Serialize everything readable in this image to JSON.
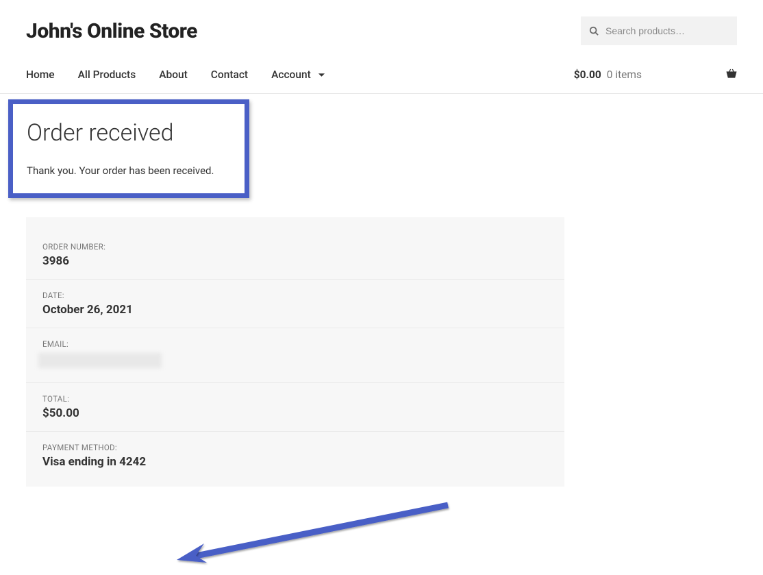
{
  "header": {
    "site_title": "John's Online Store",
    "search_placeholder": "Search products…"
  },
  "nav": {
    "items": [
      "Home",
      "All Products",
      "About",
      "Contact",
      "Account"
    ]
  },
  "cart": {
    "amount": "$0.00",
    "items_text": "0 items"
  },
  "order": {
    "page_title": "Order received",
    "thank_you": "Thank you. Your order has been received.",
    "fields": {
      "order_number_label": "ORDER NUMBER:",
      "order_number": "3986",
      "date_label": "DATE:",
      "date": "October 26, 2021",
      "email_label": "EMAIL:",
      "email": "",
      "total_label": "TOTAL:",
      "total": "$50.00",
      "payment_method_label": "PAYMENT METHOD:",
      "payment_method": "Visa ending in 4242"
    }
  },
  "colors": {
    "highlight_border": "#4a5fc6"
  }
}
